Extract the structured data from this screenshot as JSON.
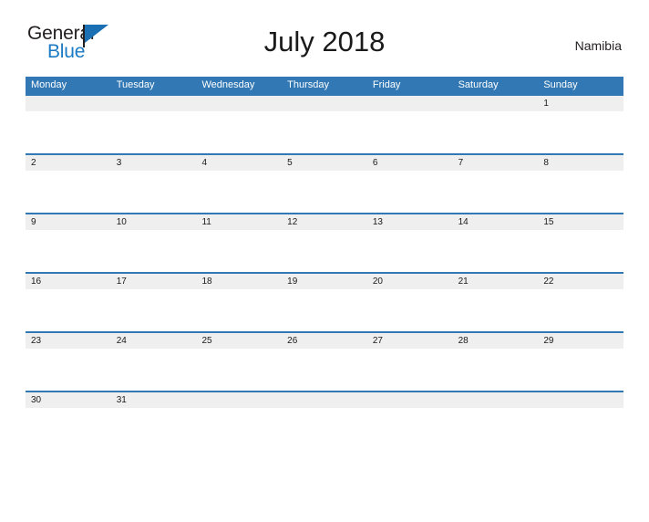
{
  "brand": {
    "word_one": "General",
    "word_two": "Blue",
    "flag_icon": "blue-triangle-flag-icon",
    "color_dark": "#231f20",
    "color_blue": "#1b7ac4"
  },
  "header": {
    "title": "July 2018",
    "country": "Namibia"
  },
  "calendar": {
    "accent_color": "#3178b4",
    "band_color": "#efefef",
    "weekdays": [
      "Monday",
      "Tuesday",
      "Wednesday",
      "Thursday",
      "Friday",
      "Saturday",
      "Sunday"
    ],
    "weeks": [
      [
        "",
        "",
        "",
        "",
        "",
        "",
        "1"
      ],
      [
        "2",
        "3",
        "4",
        "5",
        "6",
        "7",
        "8"
      ],
      [
        "9",
        "10",
        "11",
        "12",
        "13",
        "14",
        "15"
      ],
      [
        "16",
        "17",
        "18",
        "19",
        "20",
        "21",
        "22"
      ],
      [
        "23",
        "24",
        "25",
        "26",
        "27",
        "28",
        "29"
      ],
      [
        "30",
        "31",
        "",
        "",
        "",
        "",
        ""
      ]
    ]
  }
}
